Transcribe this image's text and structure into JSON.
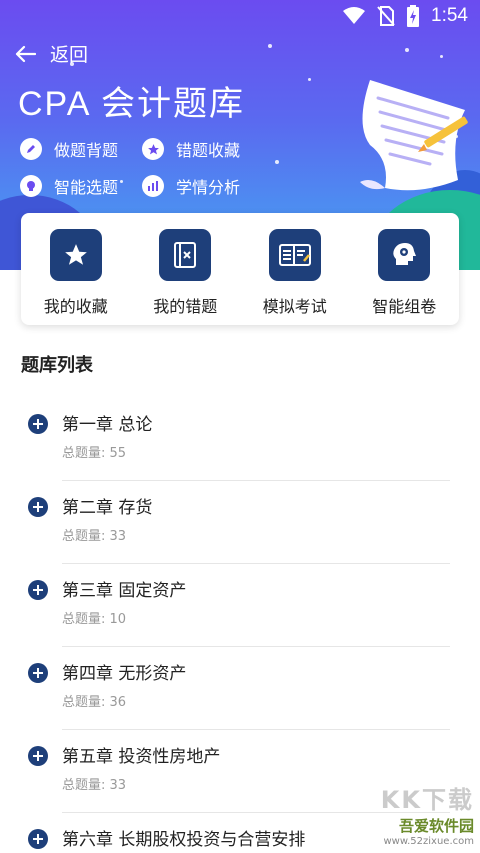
{
  "status_bar": {
    "time": "1:54",
    "icons": [
      "wifi-icon",
      "no-sim-icon",
      "battery-charging-icon"
    ]
  },
  "header": {
    "back_label": "返回",
    "title": "CPA 会计题库",
    "features": [
      {
        "label": "做题背题",
        "icon": "pencil-icon"
      },
      {
        "label": "错题收藏",
        "icon": "star-icon"
      },
      {
        "label": "智能选题",
        "icon": "brain-icon"
      },
      {
        "label": "学情分析",
        "icon": "bar-chart-icon"
      }
    ]
  },
  "quick_actions": [
    {
      "label": "我的收藏",
      "icon": "star-icon"
    },
    {
      "label": "我的错题",
      "icon": "notebook-x-icon"
    },
    {
      "label": "模拟考试",
      "icon": "exam-paper-icon"
    },
    {
      "label": "智能组卷",
      "icon": "head-gear-icon"
    }
  ],
  "section_title": "题库列表",
  "chapters": [
    {
      "title": "第一章 总论",
      "count": "总题量: 55"
    },
    {
      "title": "第二章 存货",
      "count": "总题量: 33"
    },
    {
      "title": "第三章 固定资产",
      "count": "总题量: 10"
    },
    {
      "title": "第四章 无形资产",
      "count": "总题量: 36"
    },
    {
      "title": "第五章 投资性房地产",
      "count": "总题量: 33"
    },
    {
      "title": "第六章 长期股权投资与合营安排",
      "count": ""
    }
  ],
  "watermark": {
    "big": "KK下载",
    "main": "吾爱软件园",
    "sub": "www.52zixue.com"
  },
  "colors": {
    "accent_navy": "#1e3f7a",
    "header_start": "#6b4cf0",
    "header_end": "#4aa3f2"
  }
}
